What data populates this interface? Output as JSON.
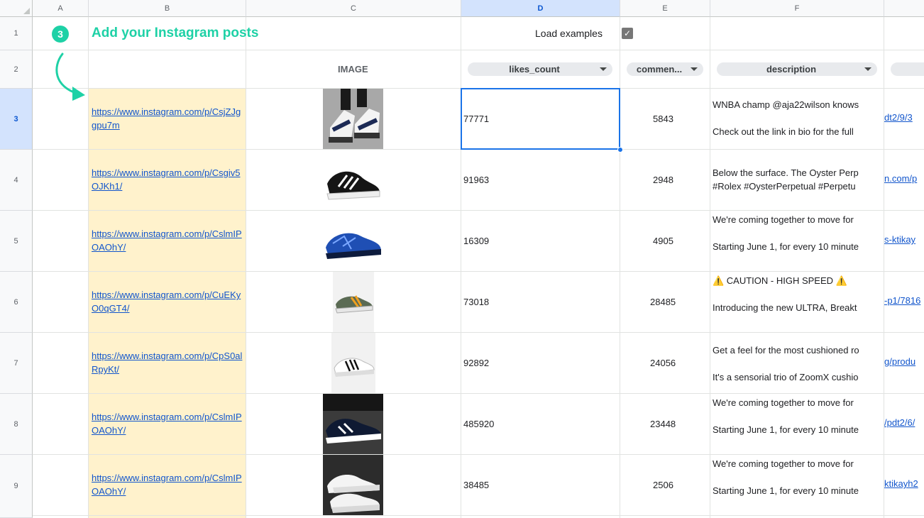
{
  "columns": [
    "A",
    "B",
    "C",
    "D",
    "E",
    "F"
  ],
  "selected_column": "D",
  "rows": [
    "1",
    "2",
    "3",
    "4",
    "5",
    "6",
    "7",
    "8",
    "9"
  ],
  "selected_row": "3",
  "title_row": {
    "step_number": "3",
    "title": "Add your Instagram posts",
    "load_examples_label": "Load examples",
    "load_examples_checked": true
  },
  "headers": {
    "image": "IMAGE",
    "likes_count": "likes_count",
    "comments_count": "commen...",
    "description": "description"
  },
  "posts": [
    {
      "url": "https://www.instagram.com/p/CsjZJggpu7m",
      "likes": "77771",
      "comments": "5843",
      "desc_lines": [
        "WNBA champ @aja22wilson knows",
        "Check out the link in bio for the full"
      ],
      "right_link": "dt2/9/3"
    },
    {
      "url": "https://www.instagram.com/p/Csgiv5OJKh1/",
      "likes": "91963",
      "comments": "2948",
      "desc_lines": [
        "Below the surface. The Oyster Perp",
        "#Rolex #OysterPerpetual #Perpetu"
      ],
      "right_link": "n.com/p"
    },
    {
      "url": "https://www.instagram.com/p/CslmIPOAOhY/",
      "likes": "16309",
      "comments": "4905",
      "desc_lines": [
        "We're coming together to move for",
        "Starting June 1, for every 10 minute"
      ],
      "right_link": "s-ktikay"
    },
    {
      "url": "https://www.instagram.com/p/CuEKyO0qGT4/",
      "likes": "73018",
      "comments": "28485",
      "desc_lines": [
        "⚠️ CAUTION - HIGH SPEED ⚠️",
        "Introducing the new ULTRA, Breakt"
      ],
      "right_link": "-p1/7816"
    },
    {
      "url": "https://www.instagram.com/p/CpS0alRpyKt/",
      "likes": "92892",
      "comments": "24056",
      "desc_lines": [
        "Get a feel for the most cushioned ro",
        "It's a sensorial trio of ZoomX cushio"
      ],
      "right_link": "g/produ"
    },
    {
      "url": "https://www.instagram.com/p/CslmIPOAOhY/",
      "likes": "485920",
      "comments": "23448",
      "desc_lines": [
        "We're coming together to move for",
        "Starting June 1, for every 10 minute"
      ],
      "right_link": "/pdt2/6/"
    },
    {
      "url": "https://www.instagram.com/p/CslmIPOAOhY/",
      "likes": "38485",
      "comments": "2506",
      "desc_lines": [
        "We're coming together to move for",
        "Starting June 1, for every 10 minute"
      ],
      "right_link": "ktikayh2"
    }
  ],
  "icons": {
    "arrow": "curved-arrow-icon",
    "dropdown": "caret-down-icon",
    "checkbox": "checkmark-icon"
  },
  "colors": {
    "accent": "#1ed1a6",
    "link": "#1155cc",
    "selection": "#1a73e8",
    "highlight": "#fff2cc"
  }
}
